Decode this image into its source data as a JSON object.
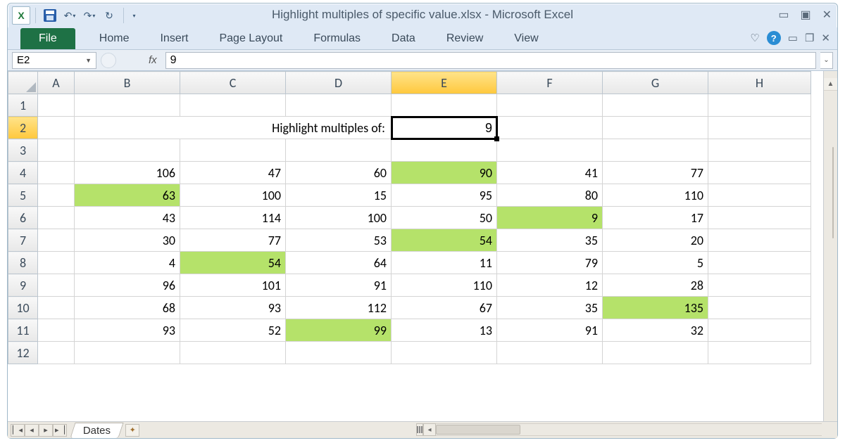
{
  "title": "Highlight multiples of specific value.xlsx - Microsoft Excel",
  "qat": {
    "undo_tip": "Undo",
    "redo_tip": "Redo",
    "refresh_tip": "Repeat"
  },
  "ribbon": {
    "file": "File",
    "tabs": [
      "Home",
      "Insert",
      "Page Layout",
      "Formulas",
      "Data",
      "Review",
      "View"
    ]
  },
  "namebox": "E2",
  "fx_label": "fx",
  "formula_value": "9",
  "columns": [
    "A",
    "B",
    "C",
    "D",
    "E",
    "F",
    "G",
    "H"
  ],
  "row_numbers": [
    1,
    2,
    3,
    4,
    5,
    6,
    7,
    8,
    9,
    10,
    11,
    12
  ],
  "label_text": "Highlight multiples of:",
  "input_value": "9",
  "selected_cell": "E2",
  "highlight_color": "#b5e26a",
  "data": [
    [
      106,
      47,
      60,
      90,
      41,
      77
    ],
    [
      63,
      100,
      15,
      95,
      80,
      110
    ],
    [
      43,
      114,
      100,
      50,
      9,
      17
    ],
    [
      30,
      77,
      53,
      54,
      35,
      20
    ],
    [
      4,
      54,
      64,
      11,
      79,
      5
    ],
    [
      96,
      101,
      91,
      110,
      12,
      28
    ],
    [
      68,
      93,
      112,
      67,
      35,
      135
    ],
    [
      93,
      52,
      99,
      13,
      91,
      32
    ]
  ],
  "sheet_tab": "Dates"
}
